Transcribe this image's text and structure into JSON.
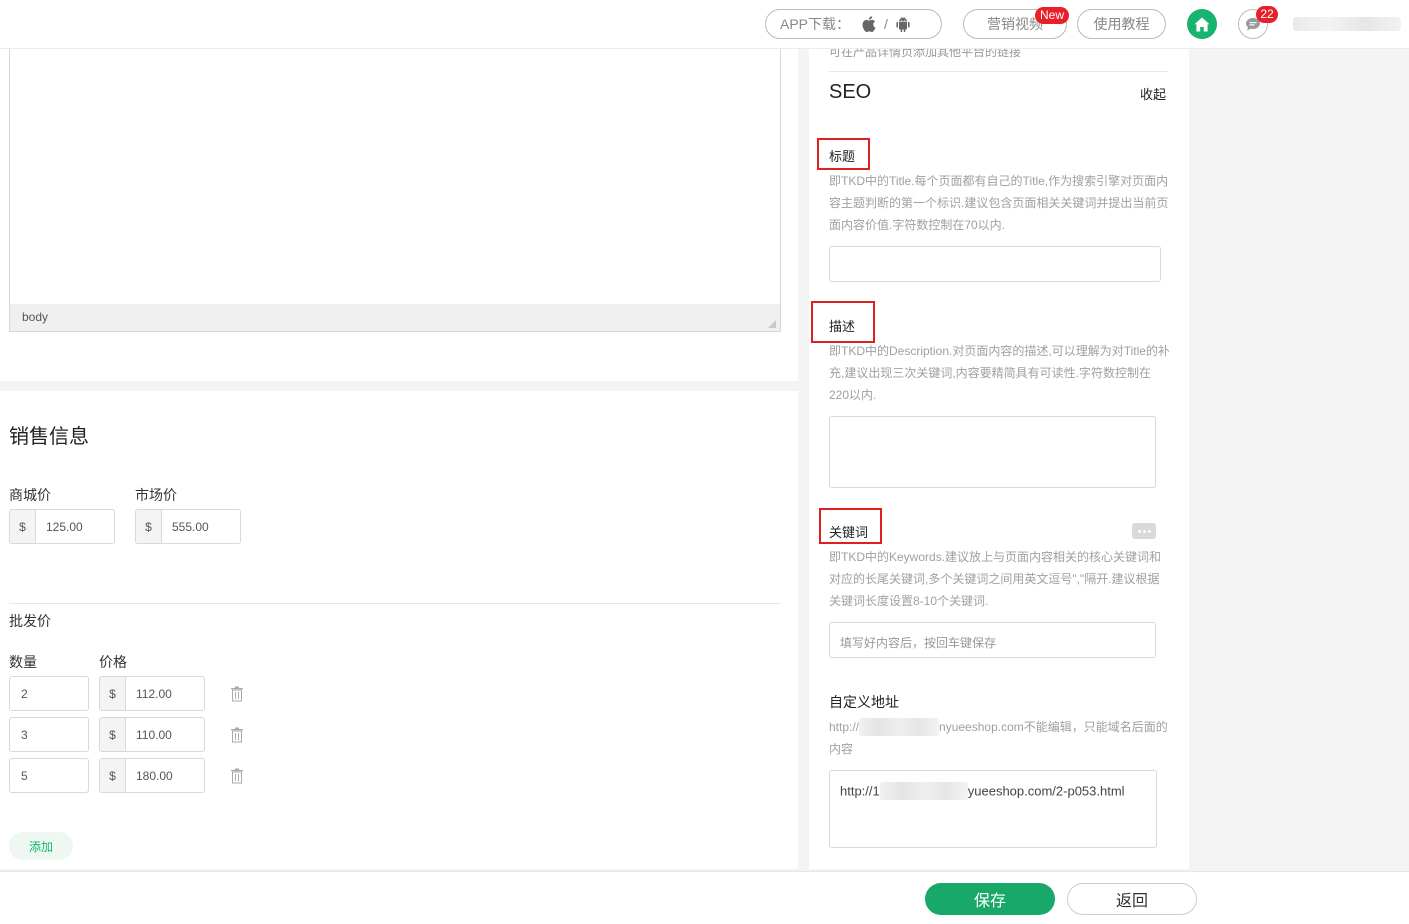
{
  "header": {
    "app_download_label": "APP下载：",
    "app_separator": "/",
    "marketing_video_label": "营销视频",
    "new_badge": "New",
    "tutorial_label": "使用教程",
    "message_count": "22"
  },
  "editor": {
    "status_path": "body"
  },
  "sales": {
    "section_title": "销售信息",
    "mall_price_label": "商城价",
    "market_price_label": "市场价",
    "currency_symbol": "$",
    "mall_price_value": "125.00",
    "market_price_value": "555.00",
    "wholesale_label": "批发价",
    "qty_header": "数量",
    "price_header": "价格",
    "wholesale_rows": [
      {
        "qty": "2",
        "price": "112.00"
      },
      {
        "qty": "3",
        "price": "110.00"
      },
      {
        "qty": "5",
        "price": "180.00"
      }
    ],
    "add_label": "添加"
  },
  "seo": {
    "top_cut_text": "可在产品详情页添加其他平台的链接",
    "section_title": "SEO",
    "collapse_label": "收起",
    "title_label": "标题",
    "title_help": "即TKD中的Title.每个页面都有自己的Title,作为搜索引擎对页面内容主题判断的第一个标识.建议包含页面相关关键词并提出当前页面内容价值.字符数控制在70以内.",
    "desc_label": "描述",
    "desc_help": "即TKD中的Description.对页面内容的描述,可以理解为对Title的补充,建议出现三次关键词,内容要精简具有可读性.字符数控制在220以内.",
    "keywords_label": "关键词",
    "keywords_help": "即TKD中的Keywords.建议放上与页面内容相关的核心关键词和对应的长尾关键词,多个关键词之间用英文逗号\",\"隔开.建议根据关键词长度设置8-10个关键词.",
    "keywords_placeholder": "填写好内容后，按回车键保存",
    "custom_url_label": "自定义地址",
    "custom_url_help_prefix": "http://",
    "custom_url_help_suffix": "nyueeshop.com不能编辑，只能域名后面的内容",
    "custom_url_value_prefix": "http://1",
    "custom_url_value_suffix": "yueeshop.com/2-p053.html"
  },
  "actions": {
    "save_label": "保存",
    "back_label": "返回"
  },
  "colors": {
    "brand_green": "#17b36f",
    "badge_red": "#e8202a",
    "annotation_red": "#e0201f"
  }
}
